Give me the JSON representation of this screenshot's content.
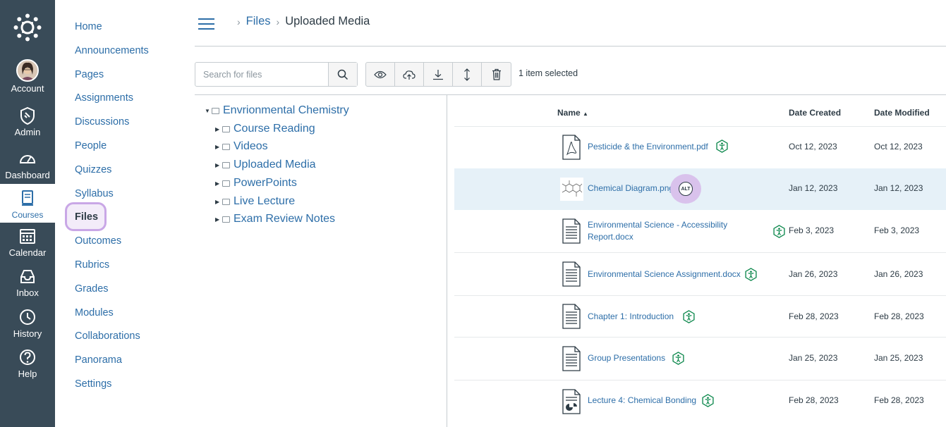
{
  "global_nav": {
    "items": [
      {
        "label": "Account",
        "icon": "avatar"
      },
      {
        "label": "Admin",
        "icon": "shield-icon"
      },
      {
        "label": "Dashboard",
        "icon": "speedometer-icon"
      },
      {
        "label": "Courses",
        "icon": "book-icon",
        "active": true
      },
      {
        "label": "Calendar",
        "icon": "calendar-icon"
      },
      {
        "label": "Inbox",
        "icon": "inbox-icon"
      },
      {
        "label": "History",
        "icon": "clock-icon"
      },
      {
        "label": "Help",
        "icon": "question-icon"
      }
    ]
  },
  "course_nav": {
    "items": [
      "Home",
      "Announcements",
      "Pages",
      "Assignments",
      "Discussions",
      "People",
      "Quizzes",
      "Syllabus",
      "Files",
      "Outcomes",
      "Rubrics",
      "Grades",
      "Modules",
      "Collaborations",
      "Panorama",
      "Settings"
    ],
    "active": "Files"
  },
  "breadcrumb": {
    "parent": "Files",
    "current": "Uploaded Media"
  },
  "search": {
    "placeholder": "Search for files"
  },
  "toolbar": {
    "selection_text": "1 item selected"
  },
  "tree": {
    "root": "Envrionmental Chemistry",
    "children": [
      "Course Reading",
      "Videos",
      "Uploaded Media",
      "PowerPoints",
      "Live Lecture",
      "Exam Review Notes"
    ]
  },
  "table": {
    "headers": {
      "name": "Name",
      "created": "Date Created",
      "modified": "Date Modified"
    },
    "rows": [
      {
        "name": "Pesticide & the Environment.pdf",
        "created": "Oct 12, 2023",
        "modified": "Oct 12, 2023",
        "type": "pdf",
        "badge": "accessibility"
      },
      {
        "name": "Chemical Diagram.png",
        "created": "Jan 12, 2023",
        "modified": "Jan 12, 2023",
        "type": "image",
        "badge": "alt",
        "selected": true
      },
      {
        "name_line1": "Environmental Science - Accessibility",
        "name_line2": "Report.docx",
        "created": "Feb 3, 2023",
        "modified": "Feb 3, 2023",
        "type": "doc",
        "badge": "accessibility"
      },
      {
        "name": "Environmental Science Assignment.docx",
        "created": "Jan 26, 2023",
        "modified": "Jan 26, 2023",
        "type": "doc",
        "badge": "accessibility"
      },
      {
        "name": "Chapter 1: Introduction",
        "created": "Feb 28, 2023",
        "modified": "Feb 28, 2023",
        "type": "doc",
        "badge": "accessibility"
      },
      {
        "name": "Group Presentations",
        "created": "Jan 25, 2023",
        "modified": "Jan 25, 2023",
        "type": "doc",
        "badge": "accessibility"
      },
      {
        "name": "Lecture 4: Chemical Bonding",
        "created": "Feb 28, 2023",
        "modified": "Feb 28, 2023",
        "type": "ppt",
        "badge": "accessibility"
      }
    ]
  },
  "colors": {
    "nav_bg": "#394b58",
    "link": "#2d6ea8",
    "highlight": "#c9a7e6",
    "accessible_green": "#0b874b"
  }
}
